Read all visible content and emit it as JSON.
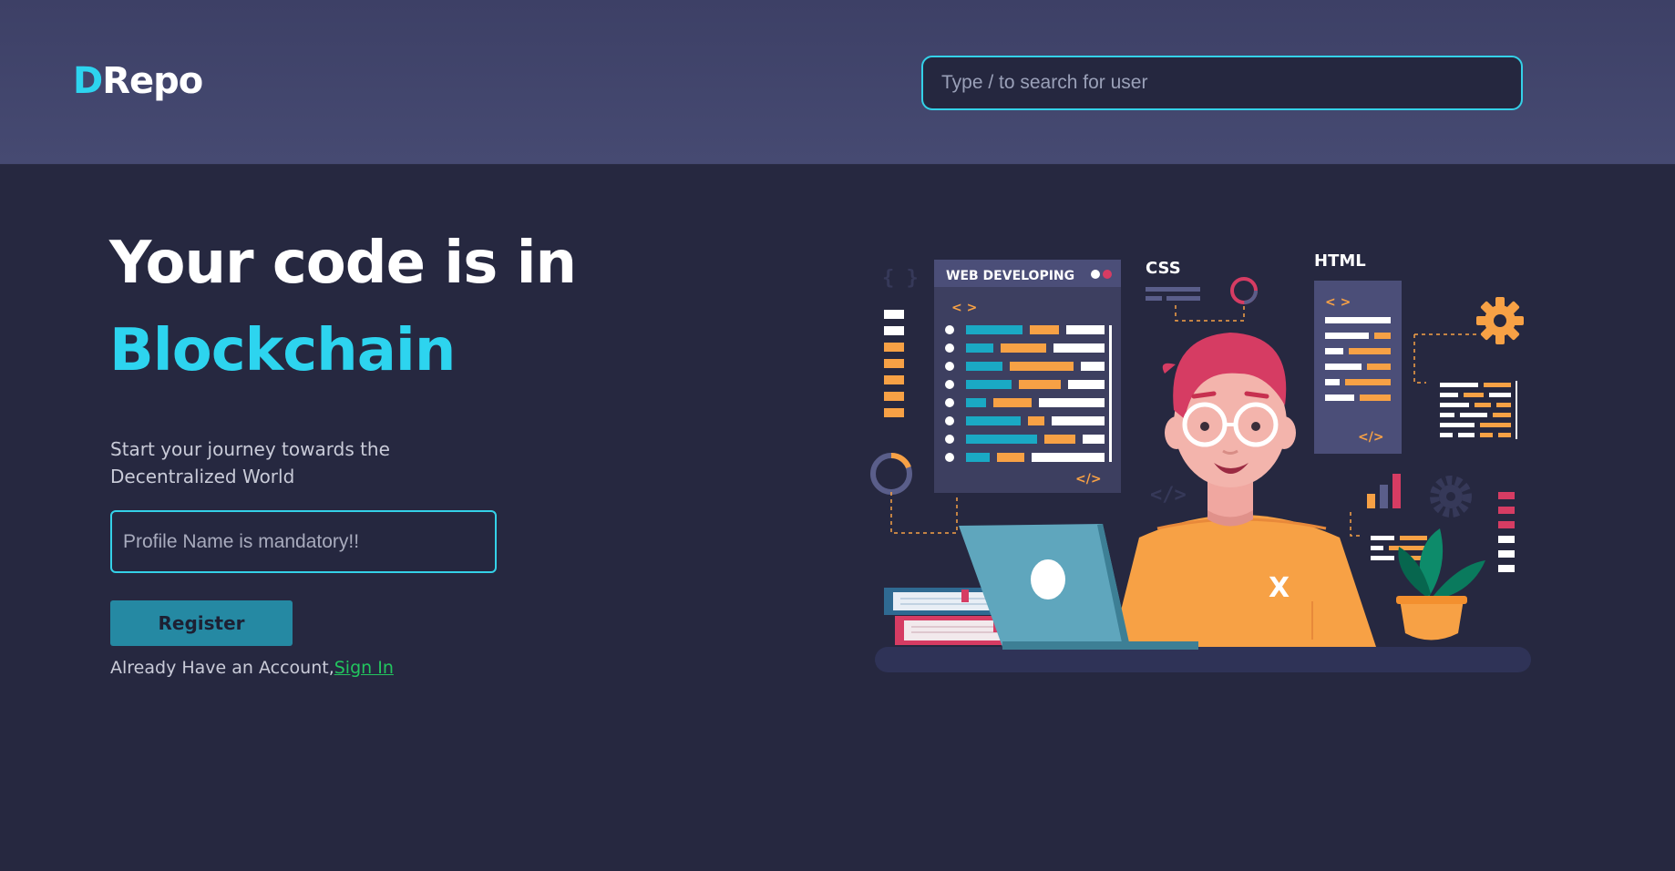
{
  "header": {
    "logo_accent": "D",
    "logo_rest": "Repo",
    "search_placeholder": "Type / to search for user"
  },
  "hero": {
    "line1": "Your code is in",
    "line2": "Blockchain",
    "tagline": "Start your journey towards the Decentralized World"
  },
  "form": {
    "profile_placeholder": "Profile Name is mandatory!!",
    "register_label": "Register",
    "account_prompt": "Already Have an Account,",
    "signin_label": "Sign In"
  },
  "illustration": {
    "panel_title": "WEB DEVELOPING",
    "css_label": "CSS",
    "html_label": "HTML",
    "open_tag": "< >",
    "close_tag": "</>",
    "shirt_letter": "X"
  },
  "colors": {
    "background": "#262840",
    "header": "#434670",
    "accent": "#2dd4ef",
    "button": "#2589a3",
    "link": "#22c55e",
    "orange": "#f7a145",
    "pink": "#d63c63"
  }
}
